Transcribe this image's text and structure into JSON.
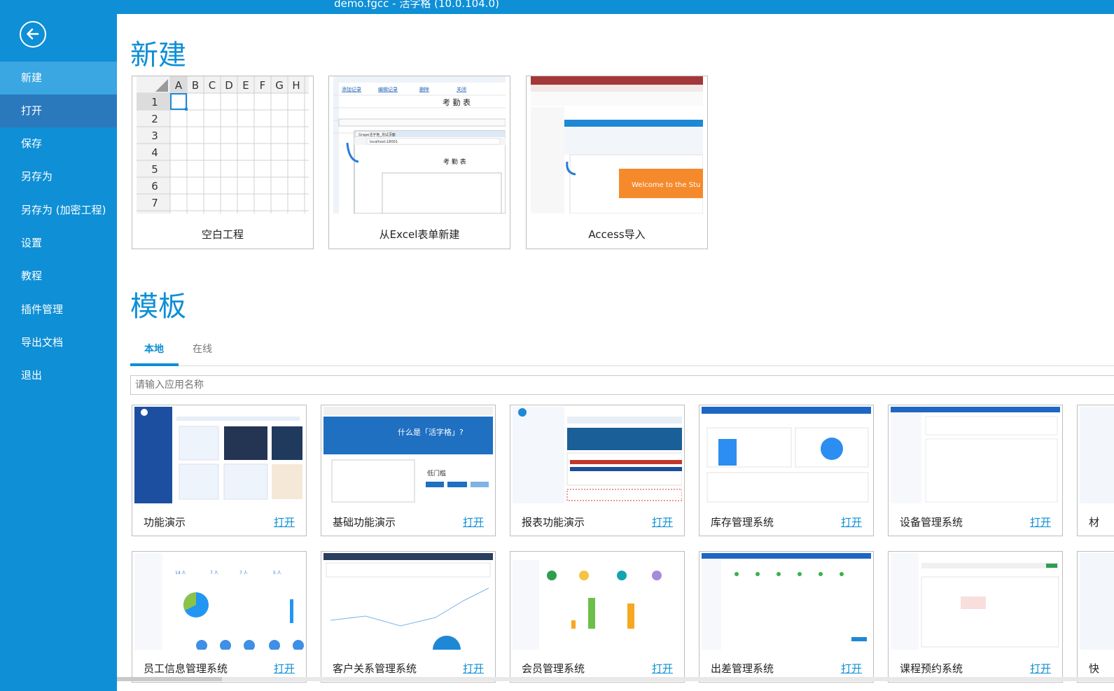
{
  "window": {
    "title": "demo.fgcc - 活字格 (10.0.104.0)"
  },
  "sidebar": {
    "items": [
      {
        "label": "新建"
      },
      {
        "label": "打开"
      },
      {
        "label": "保存"
      },
      {
        "label": "另存为"
      },
      {
        "label": "另存为 (加密工程)"
      },
      {
        "label": "设置"
      },
      {
        "label": "教程"
      },
      {
        "label": "插件管理"
      },
      {
        "label": "导出文档"
      },
      {
        "label": "退出"
      }
    ]
  },
  "new_section": {
    "title": "新建",
    "cards": [
      {
        "label": "空白工程"
      },
      {
        "label": "从Excel表单新建"
      },
      {
        "label": "Access导入"
      }
    ],
    "blank_grid": {
      "cols": [
        "A",
        "B",
        "C",
        "D",
        "E",
        "F",
        "G",
        "H"
      ],
      "rows": [
        "1",
        "2",
        "3",
        "4",
        "5",
        "6",
        "7"
      ]
    },
    "excel_preview": {
      "links": [
        "添加记录",
        "编辑记录",
        "删除",
        "关闭"
      ],
      "title": "考 勤 表",
      "url": "localhost:18001",
      "tab": "Grape活字格_测试页面"
    },
    "access_preview": {
      "banner": "Welcome to the Stu"
    }
  },
  "templates": {
    "title": "模板",
    "tabs": [
      {
        "label": "本地"
      },
      {
        "label": "在线"
      }
    ],
    "search_placeholder": "请输入应用名称",
    "open_label": "打开",
    "row1": [
      {
        "name": "功能演示"
      },
      {
        "name": "基础功能演示"
      },
      {
        "name": "报表功能演示"
      },
      {
        "name": "库存管理系统"
      },
      {
        "name": "设备管理系统"
      },
      {
        "name": "材"
      }
    ],
    "row2": [
      {
        "name": "员工信息管理系统"
      },
      {
        "name": "客户关系管理系统"
      },
      {
        "name": "会员管理系统"
      },
      {
        "name": "出差管理系统"
      },
      {
        "name": "课程预约系统"
      },
      {
        "name": "快"
      }
    ],
    "preview_text": {
      "what_is": "什么是「活字格」?",
      "low_code": "低门槛",
      "staff_count_1": "14 人",
      "staff_count_2": "7 人",
      "staff_count_3": "7 人",
      "staff_count_4": "5 人"
    }
  }
}
